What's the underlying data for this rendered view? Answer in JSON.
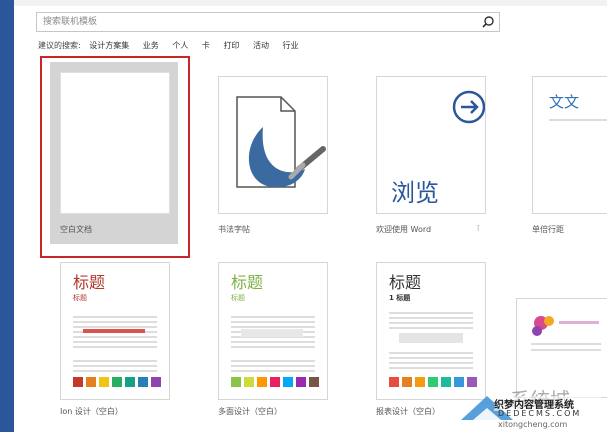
{
  "search": {
    "placeholder": "搜索联机模板"
  },
  "suggest": {
    "label": "建议的搜索:",
    "items": [
      "设计方案集",
      "业务",
      "个人",
      "卡",
      "打印",
      "活动",
      "行业"
    ]
  },
  "templates": [
    {
      "caption": "空白文档"
    },
    {
      "caption": "书法字帖"
    },
    {
      "caption": "欢迎使用 Word",
      "big_text": "浏览"
    },
    {
      "caption": "单倍行距",
      "big_text": "文文"
    },
    {
      "caption": "Ion 设计（空白）",
      "title": "标题",
      "subtitle": "标题"
    },
    {
      "caption": "多面设计（空白）",
      "title": "标题",
      "subtitle": "标题"
    },
    {
      "caption": "报表设计（空白）",
      "title": "标题",
      "subtitle": "1 标题"
    }
  ],
  "watermark": {
    "site_text": "织梦内容管理系统",
    "url": "DEDECMS.COM",
    "bottom_text": "xitongcheng.com"
  },
  "colors": {
    "selection": "#c8262b",
    "accent": "#2b579a",
    "ion_red": "#b03a2e",
    "green": "#7cb342"
  }
}
